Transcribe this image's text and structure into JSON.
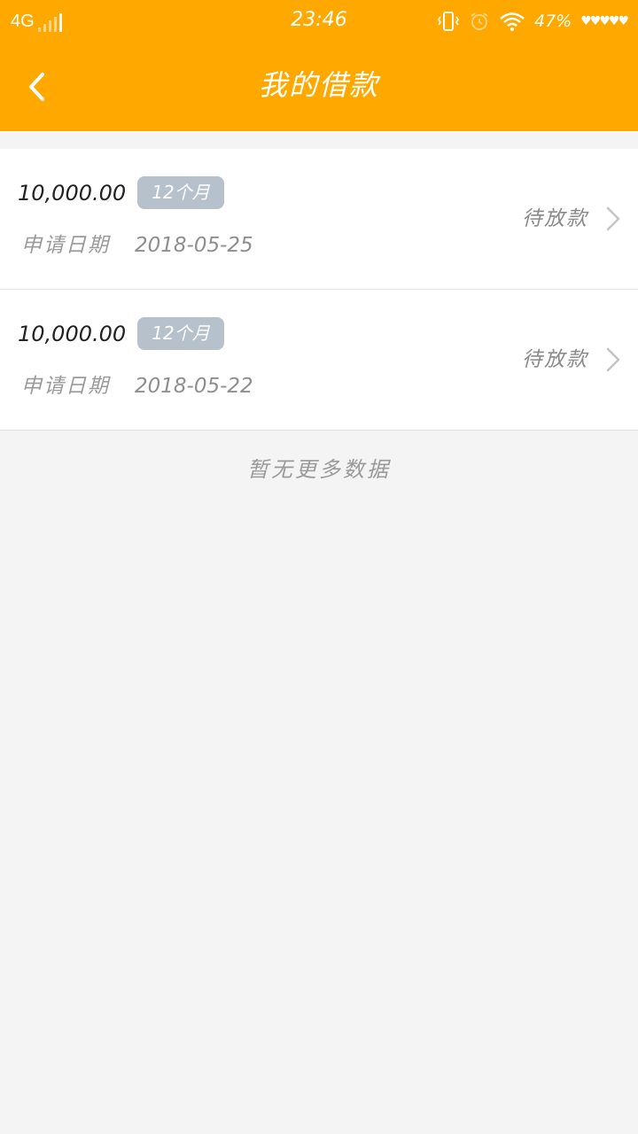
{
  "status_bar": {
    "network": "4G",
    "time": "23:46",
    "battery": "47%",
    "icons": [
      "signal-icon",
      "vibrate-icon",
      "alarm-icon",
      "wifi-icon",
      "heart-icon"
    ]
  },
  "header": {
    "title": "我的借款",
    "background_color": "#ffa800"
  },
  "loans": [
    {
      "amount": "10,000.00",
      "term": "12个月",
      "date_label": "申请日期",
      "date": "2018-05-25",
      "status": "待放款"
    },
    {
      "amount": "10,000.00",
      "term": "12个月",
      "date_label": "申请日期",
      "date": "2018-05-22",
      "status": "待放款"
    }
  ],
  "footer": {
    "no_more_text": "暂无更多数据"
  }
}
